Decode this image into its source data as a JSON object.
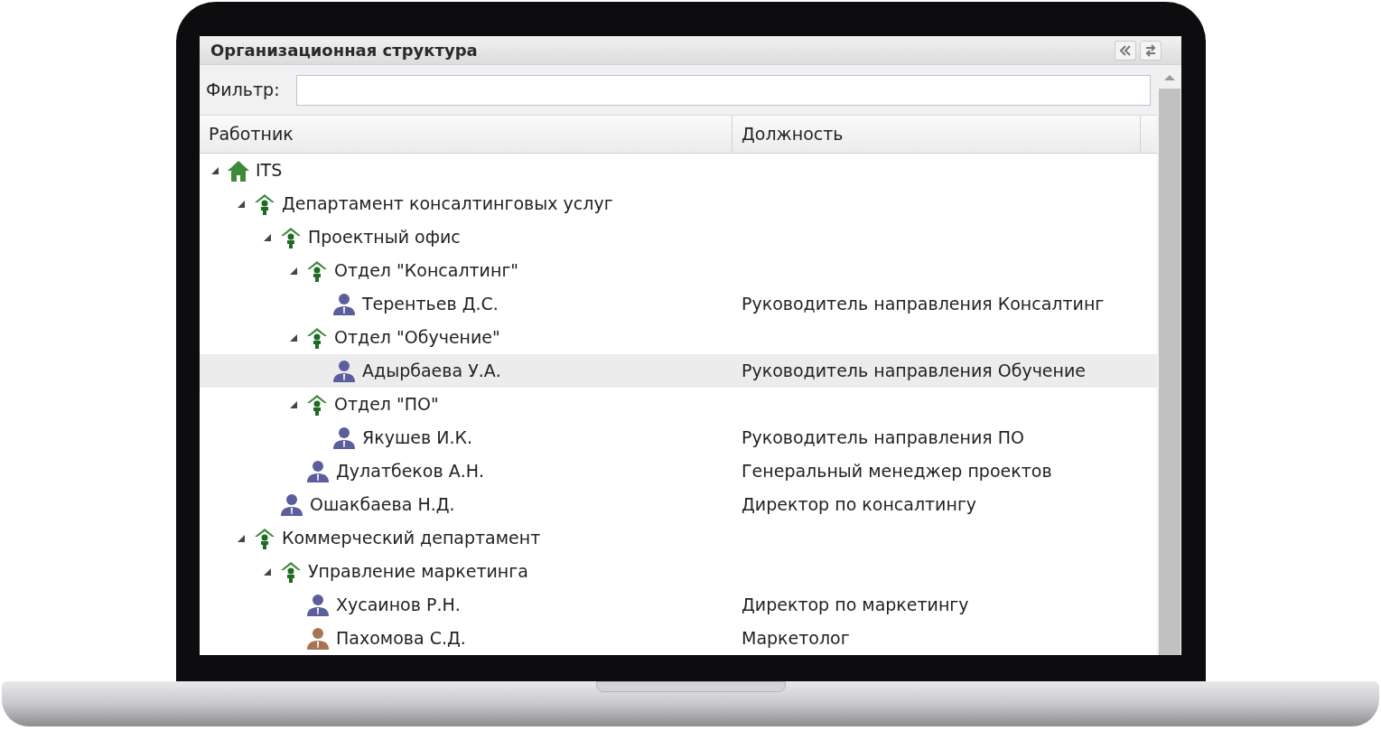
{
  "window": {
    "title": "Организационная структура"
  },
  "filter": {
    "label": "Фильтр:"
  },
  "tree": {
    "columns": [
      "Работник",
      "Должность"
    ],
    "rows": [
      {
        "kind": "root",
        "name": "ITS",
        "expanded": true,
        "selected": false,
        "children": [
          {
            "kind": "unit",
            "name": "Департамент консалтинговых услуг",
            "expanded": true,
            "selected": false,
            "children": [
              {
                "kind": "unit",
                "name": "Проектный офис",
                "expanded": true,
                "selected": false,
                "children": [
                  {
                    "kind": "unit",
                    "name": "Отдел \"Консалтинг\"",
                    "expanded": true,
                    "selected": false,
                    "children": [
                      {
                        "kind": "person",
                        "name": "Терентьев Д.С.",
                        "position": "Руководитель направления Консалтинг",
                        "color": "#5b5e9c",
                        "selected": false
                      }
                    ]
                  },
                  {
                    "kind": "unit",
                    "name": "Отдел \"Обучение\"",
                    "expanded": true,
                    "selected": false,
                    "children": [
                      {
                        "kind": "person",
                        "name": "Адырбаева У.А.",
                        "position": "Руководитель направления Обучение",
                        "color": "#5b5e9c",
                        "selected": true
                      }
                    ]
                  },
                  {
                    "kind": "unit",
                    "name": "Отдел \"ПО\"",
                    "expanded": true,
                    "selected": false,
                    "children": [
                      {
                        "kind": "person",
                        "name": "Якушев И.К.",
                        "position": "Руководитель направления ПО",
                        "color": "#5b5e9c",
                        "selected": false
                      }
                    ]
                  },
                  {
                    "kind": "person",
                    "name": "Дулатбеков А.Н.",
                    "position": "Генеральный менеджер проектов",
                    "color": "#5b5e9c",
                    "selected": false
                  }
                ]
              },
              {
                "kind": "person",
                "name": "Ошакбаева Н.Д.",
                "position": "Директор по консалтингу",
                "color": "#5b5e9c",
                "selected": false
              }
            ]
          },
          {
            "kind": "unit",
            "name": "Коммерческий департамент",
            "expanded": true,
            "selected": false,
            "children": [
              {
                "kind": "unit",
                "name": "Управление маркетинга",
                "expanded": true,
                "selected": false,
                "children": [
                  {
                    "kind": "person",
                    "name": "Хусаинов Р.Н.",
                    "position": "Директор по маркетингу",
                    "color": "#5b5e9c",
                    "selected": false
                  },
                  {
                    "kind": "person",
                    "name": "Пахомова С.Д.",
                    "position": "Маркетолог",
                    "color": "#a87452",
                    "selected": false
                  }
                ]
              }
            ]
          }
        ]
      }
    ]
  }
}
